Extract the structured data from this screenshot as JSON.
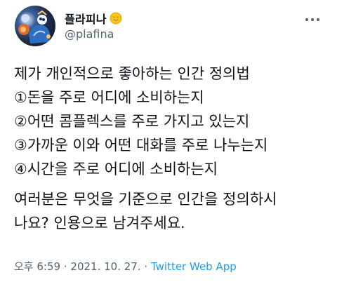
{
  "author": {
    "display_name": "플라피나",
    "handle": "@plafina",
    "avatar_icon": "avatar-illustration",
    "badge_icon": "yellow-emoji-badge-icon"
  },
  "header": {
    "more_icon": "more-options-icon"
  },
  "tweet": {
    "lines": [
      "제가 개인적으로 좋아하는 인간 정의법",
      "①돈을 주로 어디에 소비하는지",
      "②어떤 콤플렉스를 주로 가지고 있는지",
      "③가까운 이와 어떤 대화를 주로 나누는지",
      "④시간을 주로 어디에 소비하는지"
    ],
    "question_lines": [
      "여러분은 무엇을 기준으로 인간을 정의하시",
      "나요? 인용으로 남겨주세요."
    ]
  },
  "meta": {
    "time": "오후 6:59",
    "date": "2021. 10. 27.",
    "separator": "·",
    "source": "Twitter Web App"
  },
  "colors": {
    "text": "#0f1419",
    "secondary": "#536471",
    "link": "#1d9bf0",
    "badge": "#f5c518"
  }
}
